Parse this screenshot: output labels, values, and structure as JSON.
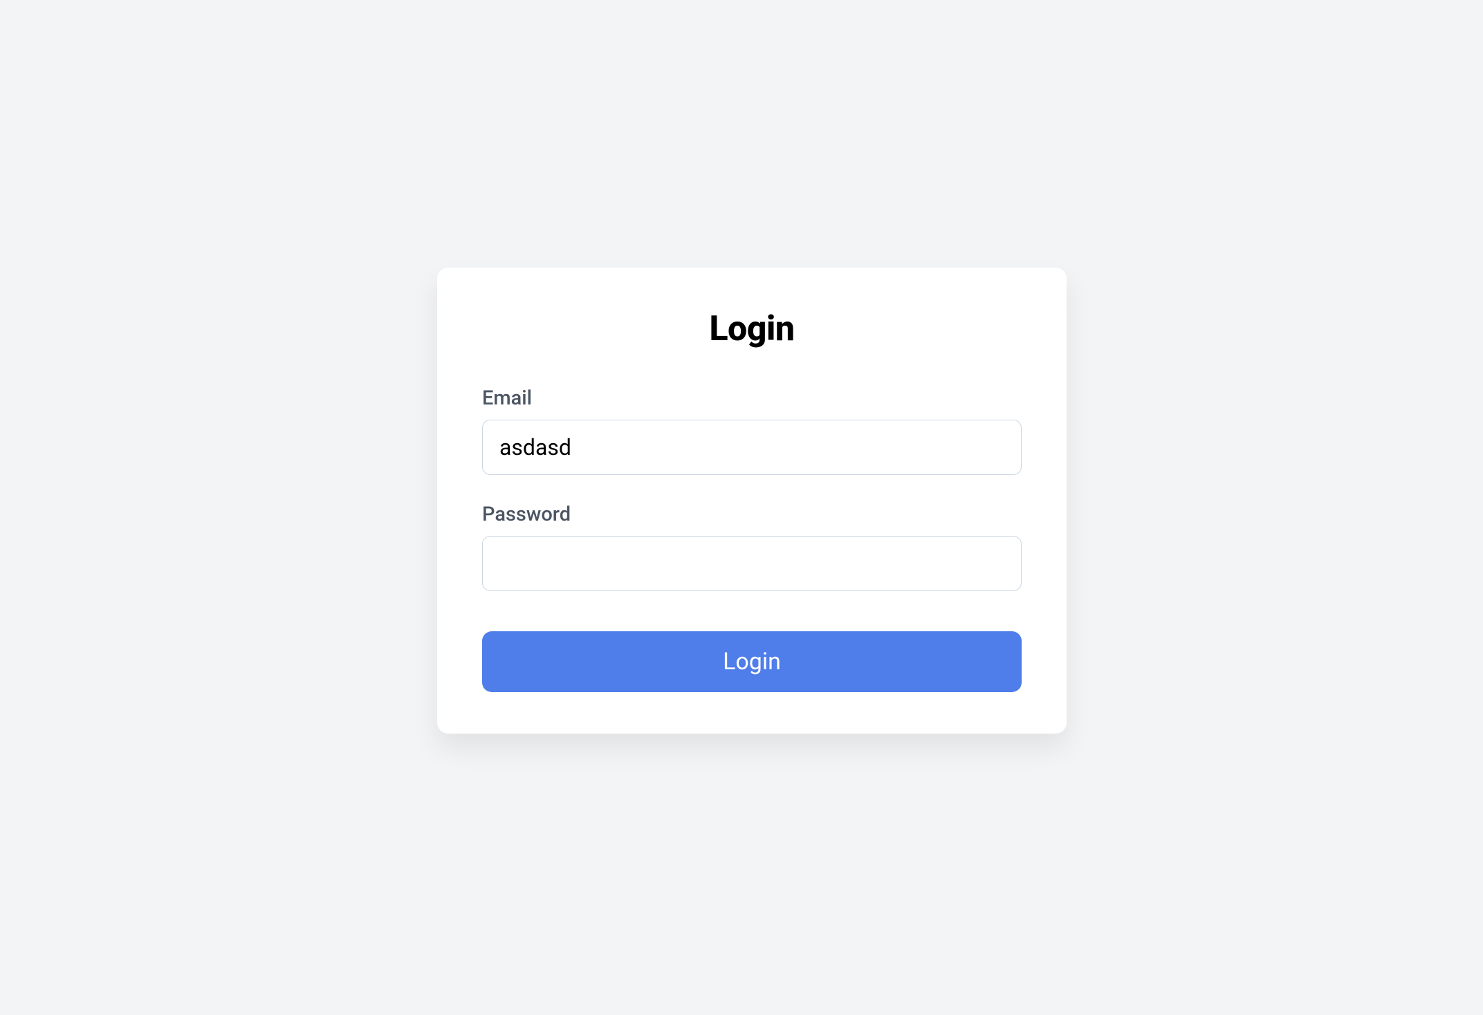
{
  "login": {
    "title": "Login",
    "email_label": "Email",
    "email_value": "asdasd",
    "password_label": "Password",
    "password_value": "",
    "button_label": "Login"
  }
}
